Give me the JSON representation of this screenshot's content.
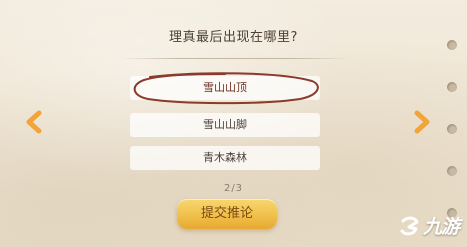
{
  "quiz": {
    "question": "理真最后出现在哪里?",
    "options": [
      {
        "label": "雪山山顶",
        "selected": true
      },
      {
        "label": "雪山山脚",
        "selected": false
      },
      {
        "label": "青木森林",
        "selected": false
      }
    ],
    "progress": "2/3",
    "submit_label": "提交推论"
  },
  "navigation": {
    "prev_icon": "chevron-left-icon",
    "next_icon": "chevron-right-icon"
  },
  "watermark": {
    "text": "九游"
  },
  "colors": {
    "arrow": "#f2a43a",
    "selection_circle": "#8a3b2b",
    "button": "#f0c04a"
  }
}
